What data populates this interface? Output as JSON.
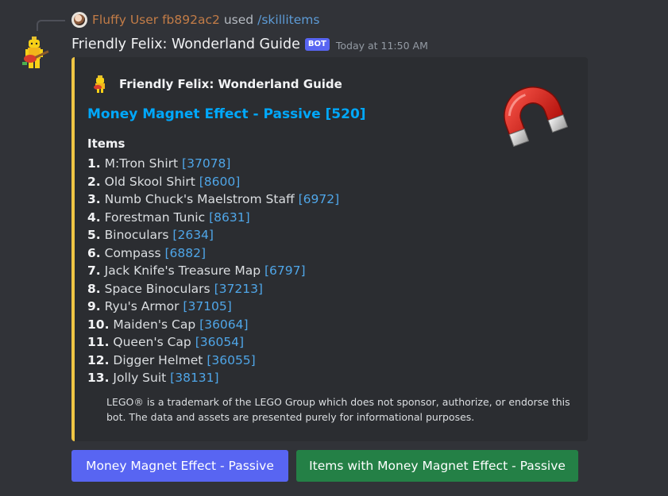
{
  "reply": {
    "user": "Fluffy User fb892ac2",
    "used": "used",
    "command": "/skillitems"
  },
  "message": {
    "author": "Friendly Felix: Wonderland Guide",
    "bot_tag": "BOT",
    "timestamp": "Today at 11:50 AM"
  },
  "embed": {
    "accent_color": "#f0c644",
    "author_name": "Friendly Felix: Wonderland Guide",
    "title": "Money Magnet Effect - Passive [520]",
    "thumbnail_icon": "magnet-icon",
    "field_name": "Items",
    "items": [
      {
        "num": "1.",
        "name": "M:Tron Shirt",
        "id": "[37078]"
      },
      {
        "num": "2.",
        "name": "Old Skool Shirt",
        "id": "[8600]"
      },
      {
        "num": "3.",
        "name": "Numb Chuck's Maelstrom Staff",
        "id": "[6972]"
      },
      {
        "num": "4.",
        "name": "Forestman Tunic",
        "id": "[8631]"
      },
      {
        "num": "5.",
        "name": "Binoculars",
        "id": "[2634]"
      },
      {
        "num": "6.",
        "name": "Compass",
        "id": "[6882]"
      },
      {
        "num": "7.",
        "name": "Jack Knife's Treasure Map",
        "id": "[6797]"
      },
      {
        "num": "8.",
        "name": "Space Binoculars",
        "id": "[37213]"
      },
      {
        "num": "9.",
        "name": "Ryu's Armor",
        "id": "[37105]"
      },
      {
        "num": "10.",
        "name": "Maiden's Cap",
        "id": "[36064]"
      },
      {
        "num": "11.",
        "name": "Queen's Cap",
        "id": "[36054]"
      },
      {
        "num": "12.",
        "name": "Digger Helmet",
        "id": "[36055]"
      },
      {
        "num": "13.",
        "name": "Jolly Suit",
        "id": "[38131]"
      }
    ],
    "footer": "LEGO® is a trademark of the LEGO Group which does not sponsor, authorize, or endorse this bot. The data and assets are presented purely for informational purposes."
  },
  "buttons": {
    "primary": "Money Magnet Effect - Passive",
    "secondary": "Items with Money Magnet Effect - Passive"
  },
  "colors": {
    "background": "#313338",
    "embed_bg": "#2b2d31",
    "link": "#00a8fc",
    "blurple": "#5865f2",
    "green": "#248046",
    "reply_user": "#c27c47"
  }
}
